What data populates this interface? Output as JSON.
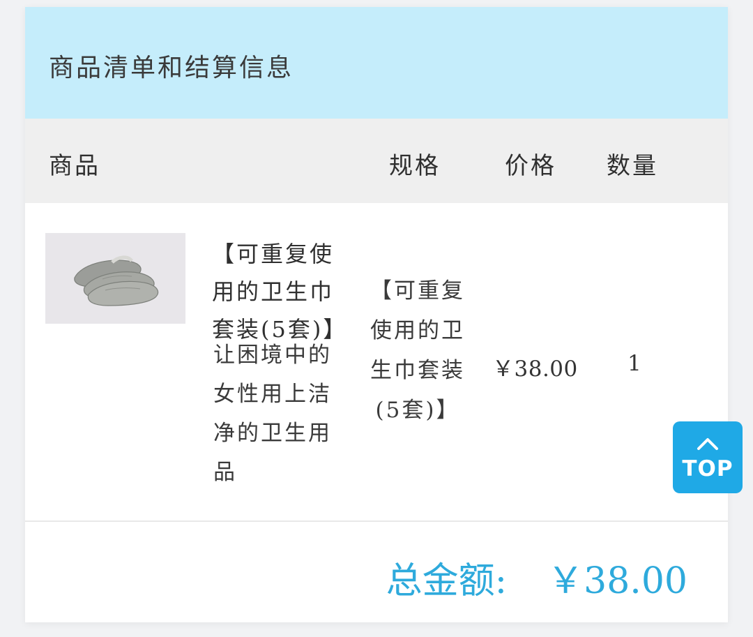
{
  "header": {
    "title": "商品清单和结算信息"
  },
  "table": {
    "columns": [
      "商品",
      "规格",
      "价格",
      "数量"
    ]
  },
  "item": {
    "name": "【可重复使用的卫生巾套装(5套)】",
    "description": "让困境中的女性用上洁净的卫生用品",
    "spec": "【可重复使用的卫生巾套装(5套)】",
    "price": "￥38.00",
    "quantity": "1",
    "image": "sanitary-pads-product-image"
  },
  "summary": {
    "total_label": "总金额:",
    "total_value": "￥38.00"
  },
  "top_button": {
    "label": "TOP",
    "icon": "chevron-up-icon"
  },
  "colors": {
    "header_bg": "#c5edfb",
    "table_head_bg": "#efefef",
    "total_accent": "#2eaadc",
    "top_button_bg": "#1fa9e6"
  }
}
